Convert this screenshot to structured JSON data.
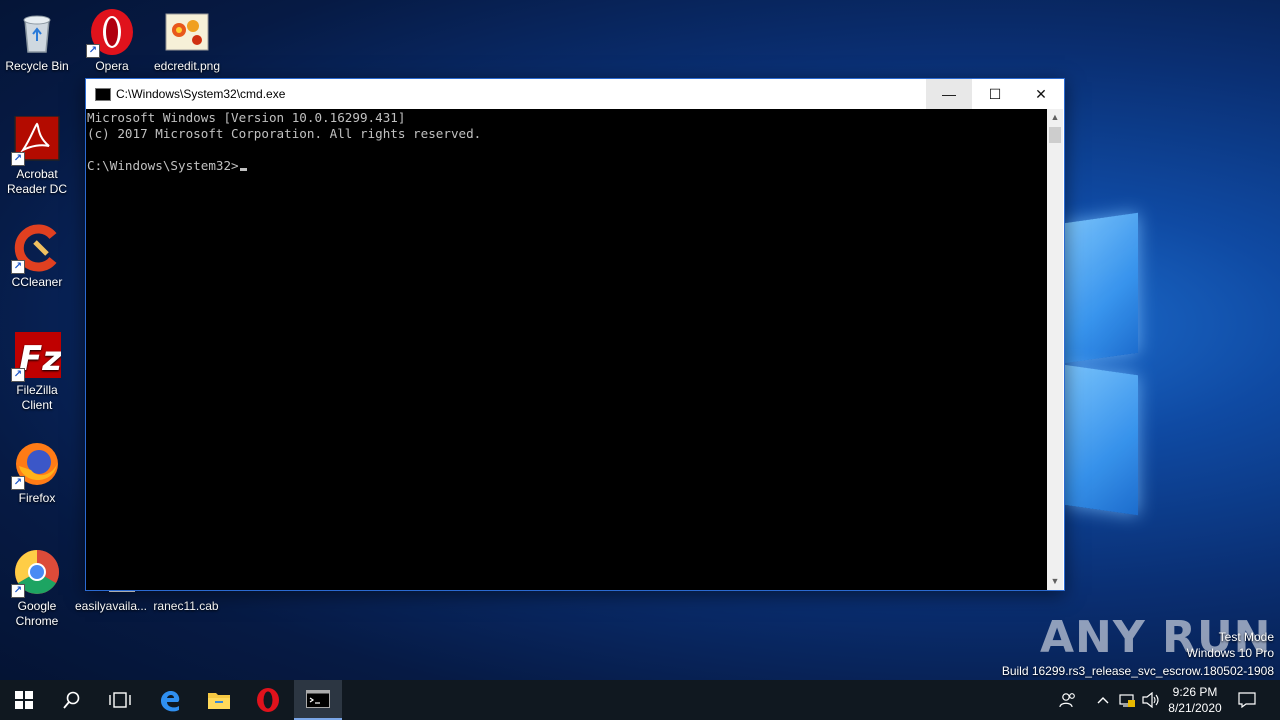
{
  "desktop": {
    "icons": [
      {
        "label": "Recycle Bin"
      },
      {
        "label": "Opera"
      },
      {
        "label": "edcredit.png"
      },
      {
        "label": "Acrobat Reader DC"
      },
      {
        "label": "CCleaner"
      },
      {
        "label": "FileZilla Client"
      },
      {
        "label": "Firefox"
      },
      {
        "label": "Google Chrome"
      },
      {
        "label": "easilyavaila..."
      },
      {
        "label": "ranec11.cab"
      }
    ]
  },
  "window": {
    "title": "C:\\Windows\\System32\\cmd.exe",
    "minimize": "—",
    "maximize": "☐",
    "close": "✕",
    "console_lines": [
      "Microsoft Windows [Version 10.0.16299.431]",
      "(c) 2017 Microsoft Corporation. All rights reserved.",
      "",
      "C:\\Windows\\System32>"
    ]
  },
  "watermark": {
    "brand": "ANY RUN",
    "line1": "Test Mode",
    "line2": "Windows 10 Pro",
    "line3": "Build 16299.rs3_release_svc_escrow.180502-1908"
  },
  "taskbar": {
    "items": [
      "start-icon",
      "search-icon",
      "task-view-icon",
      "edge-icon",
      "file-explorer-icon",
      "opera-icon",
      "cmd-icon"
    ],
    "clock_time": "9:26 PM",
    "clock_date": "8/21/2020"
  },
  "colors": {
    "accent": "#2b6ad1",
    "console_bg": "#000000",
    "console_fg": "#c0c0c0",
    "taskbar_bg": "#101820"
  }
}
